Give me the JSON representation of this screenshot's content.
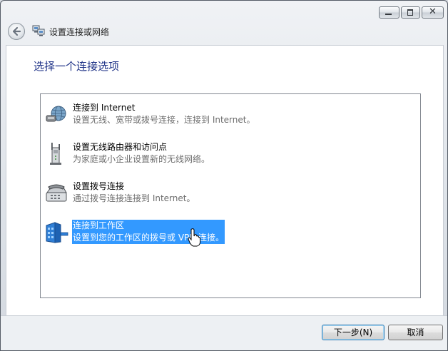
{
  "window": {
    "controls": {
      "minimize": "minimize-icon",
      "maximize": "maximize-icon",
      "close": "✕"
    }
  },
  "nav": {
    "title": "设置连接或网络"
  },
  "heading": "选择一个连接选项",
  "options": [
    {
      "title": "连接到 Internet",
      "desc": "设置无线、宽带或拨号连接，连接到 Internet。",
      "icon": "globe-network-icon"
    },
    {
      "title": "设置无线路由器和访问点",
      "desc": "为家庭或小企业设置新的无线网络。",
      "icon": "wireless-router-icon"
    },
    {
      "title": "设置拨号连接",
      "desc": "通过拨号连接连接到 Internet。",
      "icon": "telephone-modem-icon"
    },
    {
      "title": "连接到工作区",
      "desc": "设置到您的工作区的拨号或 VPN 连接。",
      "icon": "workplace-building-icon",
      "selected": true
    }
  ],
  "buttons": {
    "next": "下一步(N)",
    "cancel": "取消"
  },
  "colors": {
    "selection": "#3399ff",
    "heading": "#1e3287"
  }
}
